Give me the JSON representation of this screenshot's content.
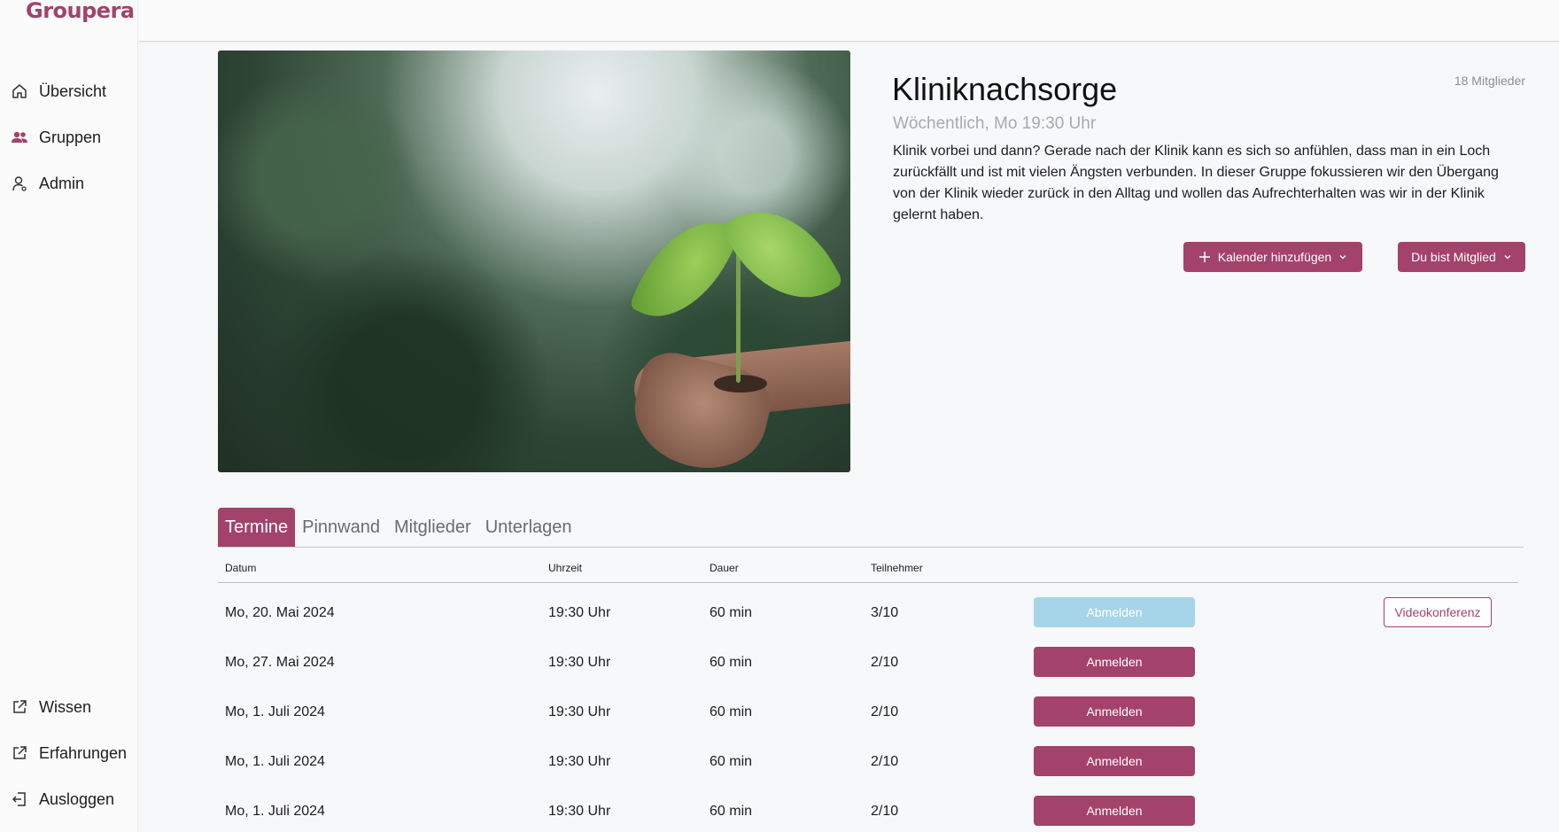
{
  "app": {
    "logo": "Groupera",
    "accent_color": "#a3426b"
  },
  "sidebar": {
    "items": [
      {
        "label": "Übersicht",
        "icon": "home-icon"
      },
      {
        "label": "Gruppen",
        "icon": "users-icon"
      },
      {
        "label": "Admin",
        "icon": "user-icon"
      }
    ],
    "bottom_items": [
      {
        "label": "Wissen",
        "icon": "external-link-icon"
      },
      {
        "label": "Erfahrungen",
        "icon": "external-link-icon"
      },
      {
        "label": "Ausloggen",
        "icon": "logout-icon"
      }
    ]
  },
  "group": {
    "title": "Kliniknachsorge",
    "members_count": "18 Mitglieder",
    "schedule": "Wöchentlich, Mo 19:30 Uhr",
    "description": "Klinik vorbei und dann? Gerade nach der Klinik kann es sich so anfühlen, dass man in ein Loch zurückfällt und ist mit vielen Ängsten verbunden. In dieser Gruppe fokussieren wir den Übergang von der Klinik wieder zurück in den Alltag und wollen das Aufrechterhalten was wir in der Klinik gelernt haben.",
    "calendar_button": "Kalender hinzufügen",
    "member_button": "Du bist Mitglied"
  },
  "tabs": [
    {
      "label": "Termine",
      "active": true
    },
    {
      "label": "Pinnwand",
      "active": false
    },
    {
      "label": "Mitglieder",
      "active": false
    },
    {
      "label": "Unterlagen",
      "active": false
    }
  ],
  "table": {
    "headers": {
      "date": "Datum",
      "time": "Uhrzeit",
      "duration": "Dauer",
      "participants": "Teilnehmer"
    },
    "rows": [
      {
        "date": "Mo, 20. Mai 2024",
        "time": "19:30 Uhr",
        "duration": "60 min",
        "participants": "3/10",
        "action": "Abmelden",
        "video": "Videokonferenz"
      },
      {
        "date": "Mo, 27. Mai 2024",
        "time": "19:30 Uhr",
        "duration": "60 min",
        "participants": "2/10",
        "action": "Anmelden"
      },
      {
        "date": "Mo, 1. Juli 2024",
        "time": "19:30 Uhr",
        "duration": "60 min",
        "participants": "2/10",
        "action": "Anmelden"
      },
      {
        "date": "Mo, 1. Juli 2024",
        "time": "19:30 Uhr",
        "duration": "60 min",
        "participants": "2/10",
        "action": "Anmelden"
      },
      {
        "date": "Mo, 1. Juli 2024",
        "time": "19:30 Uhr",
        "duration": "60 min",
        "participants": "2/10",
        "action": "Anmelden"
      }
    ]
  }
}
